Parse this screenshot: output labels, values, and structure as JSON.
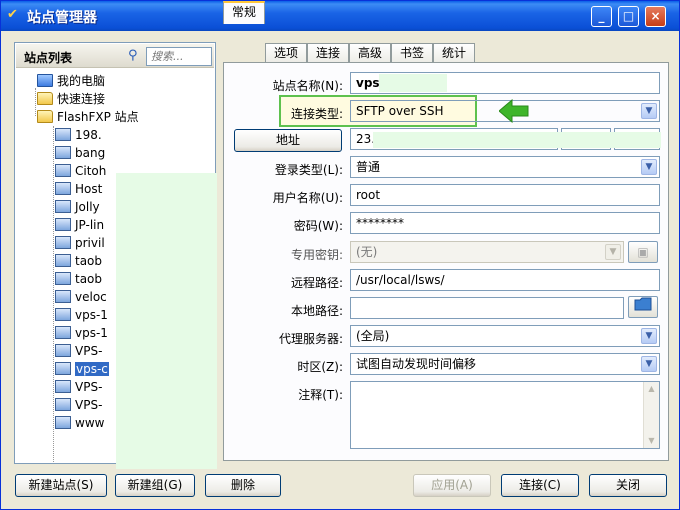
{
  "window": {
    "title": "站点管理器",
    "controls": [
      "_",
      "□",
      "×"
    ]
  },
  "sidebar": {
    "title": "站点列表",
    "search_placeholder": "搜索...",
    "tree": [
      {
        "label": "我的电脑",
        "icon": "pc-icon",
        "level": 0
      },
      {
        "label": "快速连接",
        "icon": "folder-icon",
        "level": 0
      },
      {
        "label": "FlashFXP 站点",
        "icon": "folder-icon",
        "level": 0
      },
      {
        "label": "198.",
        "icon": "site-icon",
        "level": 1
      },
      {
        "label": "bang",
        "icon": "site-icon",
        "level": 1
      },
      {
        "label": "Citoh",
        "icon": "site-icon",
        "level": 1
      },
      {
        "label": "Host",
        "icon": "site-icon",
        "level": 1
      },
      {
        "label": "Jolly",
        "icon": "site-icon",
        "level": 1
      },
      {
        "label": "JP-lin",
        "icon": "site-icon",
        "level": 1
      },
      {
        "label": "privil",
        "icon": "site-icon",
        "level": 1
      },
      {
        "label": "taob",
        "icon": "site-icon",
        "level": 1
      },
      {
        "label": "taob",
        "icon": "site-icon",
        "level": 1
      },
      {
        "label": "veloc",
        "icon": "site-icon",
        "level": 1
      },
      {
        "label": "vps-1",
        "icon": "site-icon",
        "level": 1
      },
      {
        "label": "vps-1",
        "icon": "site-icon",
        "level": 1
      },
      {
        "label": "VPS-",
        "icon": "site-icon",
        "level": 1
      },
      {
        "label": "vps-c",
        "icon": "site-icon",
        "level": 1,
        "selected": true
      },
      {
        "label": "VPS-",
        "icon": "site-icon",
        "level": 1
      },
      {
        "label": "VPS-",
        "icon": "site-icon",
        "level": 1
      },
      {
        "label": "www",
        "icon": "site-icon",
        "level": 1
      }
    ]
  },
  "tabs": [
    "常规",
    "选项",
    "连接",
    "高级",
    "书签",
    "统计"
  ],
  "form": {
    "site_name_label": "站点名称(N):",
    "site_name_value": "vps",
    "conn_type_label": "连接类型:",
    "conn_type_value": "SFTP over SSH",
    "address_button": "地址",
    "address_value": "23.",
    "login_type_label": "登录类型(L):",
    "login_type_value": "普通",
    "username_label": "用户名称(U):",
    "username_value": "root",
    "password_label": "密码(W):",
    "password_value": "********",
    "private_key_label": "专用密钥:",
    "private_key_value": "(无)",
    "remote_path_label": "远程路径:",
    "remote_path_value": "/usr/local/lsws/",
    "local_path_label": "本地路径:",
    "local_path_value": "",
    "proxy_label": "代理服务器:",
    "proxy_value": "(全局)",
    "timezone_label": "时区(Z):",
    "timezone_value": "试图自动发现时间偏移",
    "notes_label": "注释(T):",
    "notes_value": ""
  },
  "footer": {
    "new_site": "新建站点(S)",
    "new_group": "新建组(G)",
    "delete": "删除",
    "apply": "应用(A)",
    "connect": "连接(C)",
    "close": "关闭"
  },
  "colors": {
    "highlight_border": "#5ec14e",
    "arrow": "#3fb52a",
    "selection": "#316ac5",
    "titlebar": "#0a4fd6"
  }
}
